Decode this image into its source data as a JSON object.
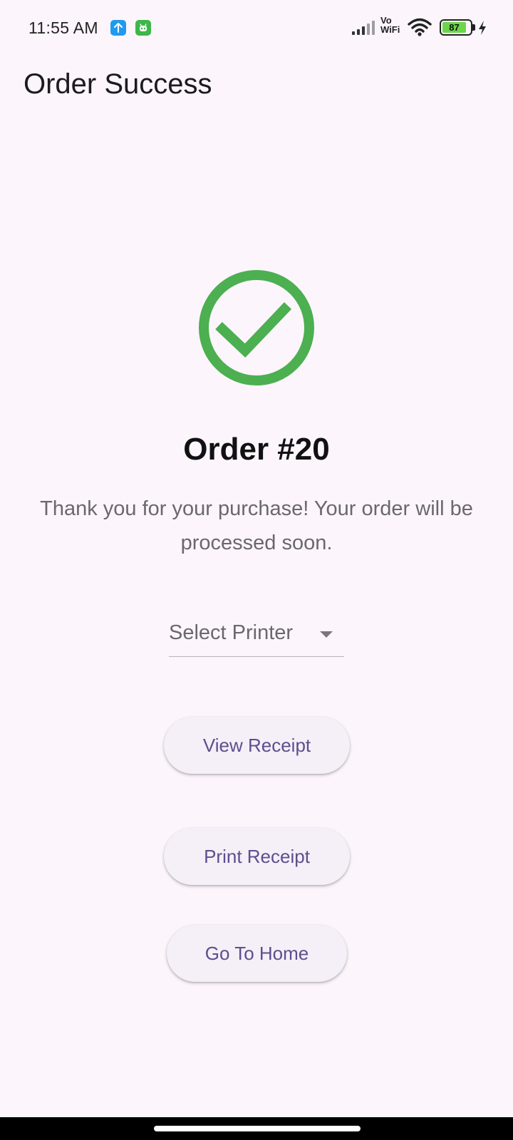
{
  "status_bar": {
    "time": "11:55 AM",
    "notification_icons": [
      "upload-icon",
      "android-bot-icon"
    ],
    "vowifi_top": "Vo",
    "vowifi_bottom": "WiFi",
    "battery_level": "87",
    "battery_fraction": 0.87,
    "battery_color": "#6CD64B",
    "charging": true
  },
  "app_bar": {
    "title": "Order Success"
  },
  "success": {
    "icon": "check-circle-icon",
    "icon_color": "#4CAF50",
    "order_title": "Order #20",
    "message": "Thank you for your purchase! Your order will be processed soon."
  },
  "printer_dropdown": {
    "placeholder": "Select Printer",
    "icon": "caret-down-icon"
  },
  "actions": {
    "view_receipt": "View Receipt",
    "print_receipt": "Print Receipt",
    "go_home": "Go To Home",
    "accent_color": "#5E4E8E"
  }
}
